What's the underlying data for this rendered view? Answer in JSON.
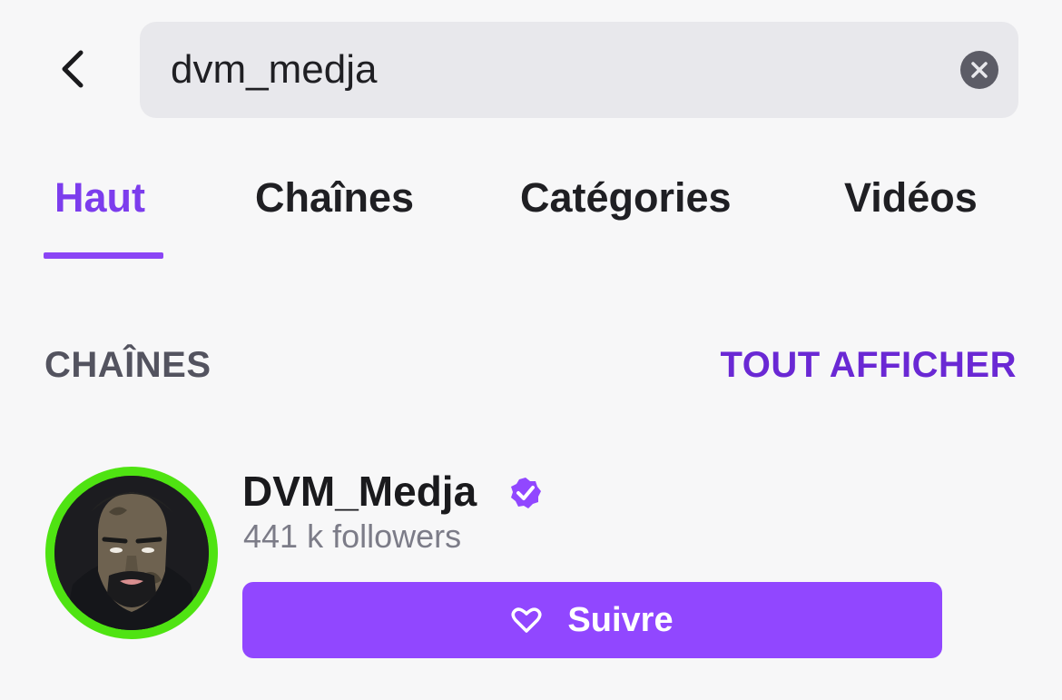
{
  "search": {
    "value": "dvm_medja",
    "back_icon": "chevron-left-icon",
    "clear_icon": "close-circle-icon"
  },
  "tabs": [
    {
      "label": "Haut",
      "active": true
    },
    {
      "label": "Chaînes",
      "active": false
    },
    {
      "label": "Catégories",
      "active": false
    },
    {
      "label": "Vidéos",
      "active": false
    }
  ],
  "section": {
    "title": "CHAÎNES",
    "view_all": "TOUT AFFICHER"
  },
  "channel": {
    "name": "DVM_Medja",
    "verified": true,
    "followers": "441 k followers",
    "follow_label": "Suivre",
    "follow_icon": "heart-icon"
  },
  "colors": {
    "accent": "#9147ff",
    "accent_text": "#7c3ded",
    "avatar_ring": "#4fe312",
    "background": "#f7f7f8",
    "search_bg": "#e8e8ec"
  }
}
